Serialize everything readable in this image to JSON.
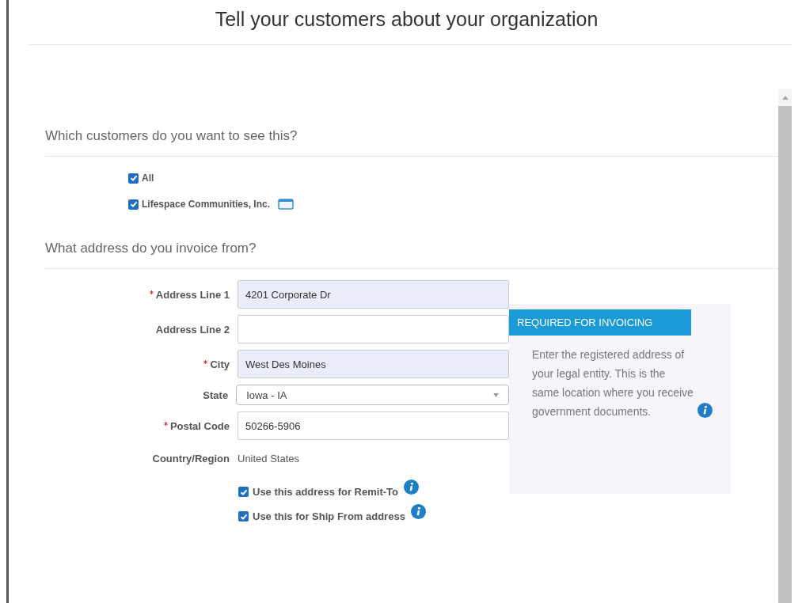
{
  "title": "Tell your customers about your organization",
  "customers": {
    "heading": "Which customers do you want to see this?",
    "options": [
      {
        "label": "All",
        "checked": true,
        "card_icon": false
      },
      {
        "label": "Lifespace Communities, Inc.",
        "checked": true,
        "card_icon": true
      }
    ]
  },
  "address": {
    "heading": "What address do you invoice from?",
    "fields": [
      {
        "kind": "text",
        "label": "Address Line 1",
        "required": true,
        "value": "4201 Corporate Dr",
        "filled": true
      },
      {
        "kind": "text",
        "label": "Address Line 2",
        "required": false,
        "filled": false
      },
      {
        "kind": "text",
        "label": "City",
        "required": true,
        "value": "West Des Moines",
        "filled": true
      },
      {
        "kind": "select",
        "label": "State",
        "required": false,
        "value": "Iowa - IA"
      },
      {
        "kind": "text",
        "label": "Postal Code",
        "required": true,
        "value": "50266-5906",
        "filled": false
      },
      {
        "kind": "static",
        "label": "Country/Region",
        "required": false,
        "value": "United States"
      }
    ],
    "options": [
      {
        "label": "Use this address for Remit-To",
        "checked": true
      },
      {
        "label": "Use this for Ship From address",
        "checked": true
      }
    ]
  },
  "info_panel": {
    "badge": "REQUIRED FOR INVOICING",
    "text": "Enter the registered address of your legal entity. This is the same location where you receive government documents."
  }
}
